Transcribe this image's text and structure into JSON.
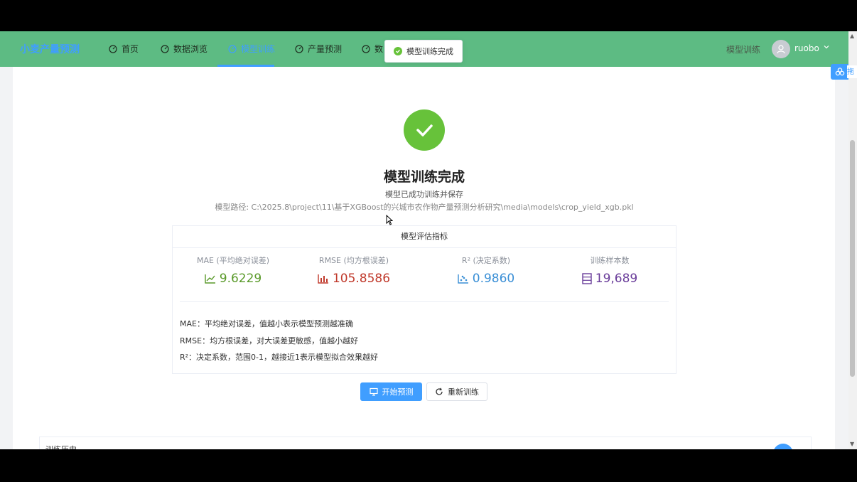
{
  "brand": "小麦产量预测",
  "nav": [
    {
      "label": "首页",
      "icon": "dashboard-icon",
      "active": false
    },
    {
      "label": "数据浏览",
      "icon": "dashboard-icon",
      "active": false
    },
    {
      "label": "模型训练",
      "icon": "dashboard-icon",
      "active": true
    },
    {
      "label": "产量预测",
      "icon": "dashboard-icon",
      "active": false
    },
    {
      "label": "数",
      "icon": "dashboard-icon",
      "active": false
    }
  ],
  "header_right": {
    "label": "模型训练",
    "username": "ruobo"
  },
  "toast": {
    "message": "模型训练完成"
  },
  "side_widget_text": "拖",
  "result": {
    "title": "模型训练完成",
    "subtitle": "模型已成功训练并保存",
    "path": "模型路径: C:\\2025.8\\project\\11\\基于XGBoost的兴城市农作物产量预测分析研究\\media\\models\\crop_yield_xgb.pkl"
  },
  "metrics": {
    "header": "模型评估指标",
    "items": [
      {
        "label": "MAE (平均绝对误差)",
        "value": "9.6229",
        "icon": "line-chart-icon",
        "color": "#5a9a2a"
      },
      {
        "label": "RMSE (均方根误差)",
        "value": "105.8586",
        "icon": "bar-chart-icon",
        "color": "#c0392b"
      },
      {
        "label": "R² (决定系数)",
        "value": "0.9860",
        "icon": "scatter-chart-icon",
        "color": "#3a8fd6"
      },
      {
        "label": "训练样本数",
        "value": "19,689",
        "icon": "database-icon",
        "color": "#6a3d9a"
      }
    ],
    "notes": [
      "MAE：平均绝对误差，值越小表示模型预测越准确",
      "RMSE：均方根误差，对大误差更敏感，值越小越好",
      "R²：决定系数，范围0-1，越接近1表示模型拟合效果越好"
    ]
  },
  "buttons": {
    "predict": "开始预测",
    "retrain": "重新训练"
  },
  "history": {
    "title": "训练历史"
  }
}
